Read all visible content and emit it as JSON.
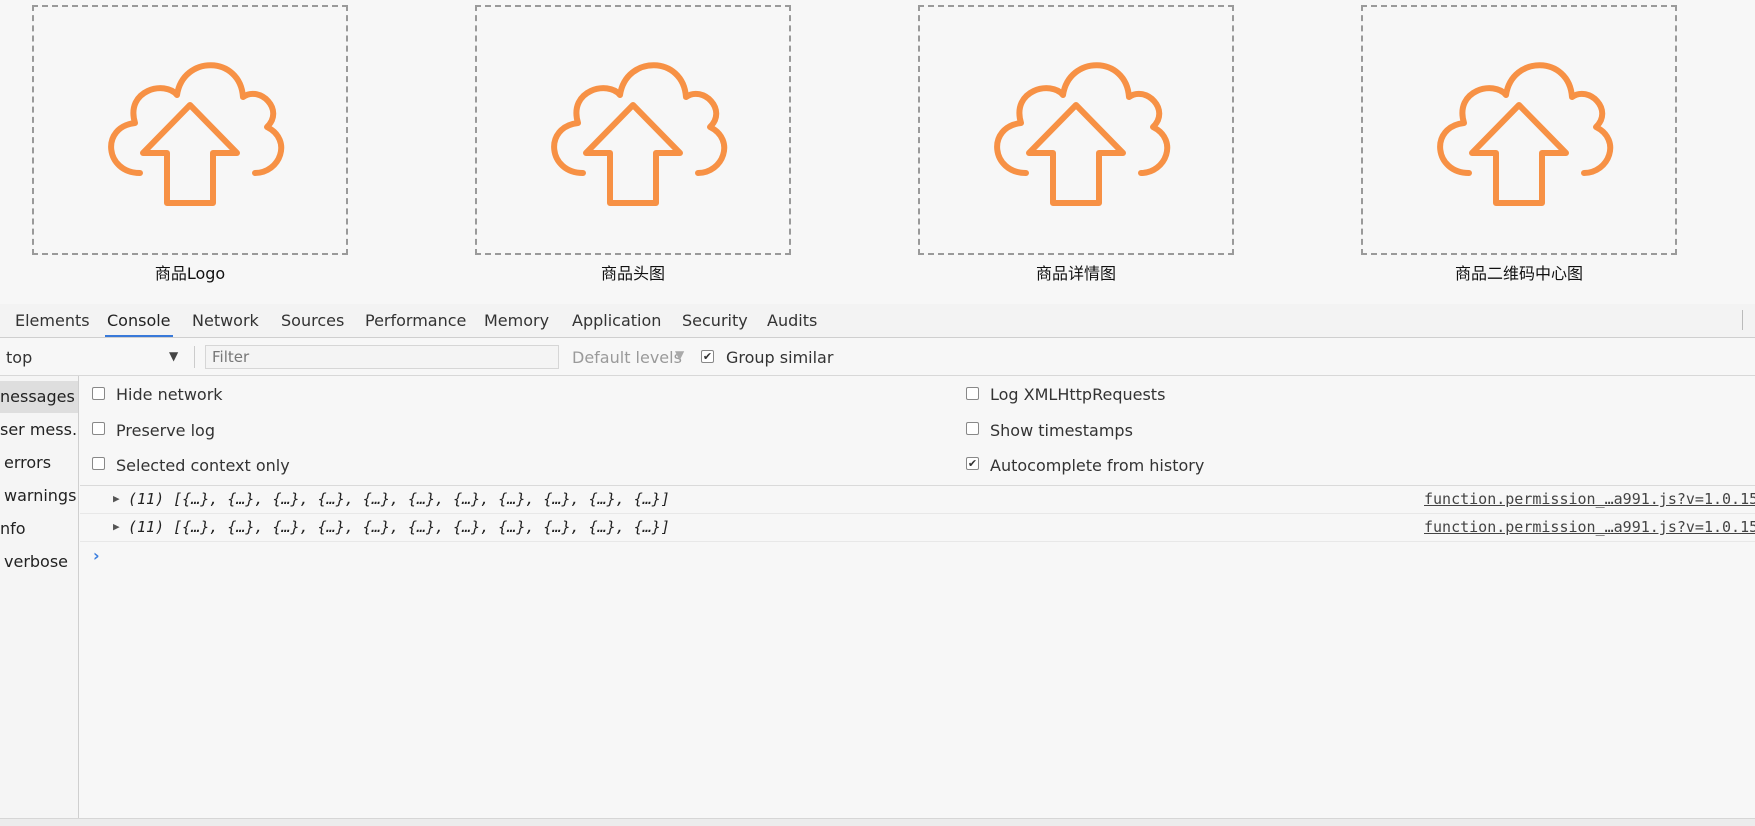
{
  "uploads": [
    {
      "label": "商品Logo"
    },
    {
      "label": "商品头图"
    },
    {
      "label": "商品详情图"
    },
    {
      "label": "商品二维码中心图"
    }
  ],
  "upload_icon": "cloud-upload-icon",
  "upload_icon_color": "#f79145",
  "tabs": [
    "Elements",
    "Console",
    "Network",
    "Sources",
    "Performance",
    "Memory",
    "Application",
    "Security",
    "Audits"
  ],
  "active_tab": "Console",
  "toolbar": {
    "context": "top",
    "filter_placeholder": "Filter",
    "levels": "Default levels",
    "group_similar": "Group similar"
  },
  "sidebar": {
    "items": [
      "nessages",
      "ser mess...",
      "errors",
      "warnings",
      "nfo",
      "verbose"
    ]
  },
  "settings": {
    "hide_network": "Hide network",
    "preserve_log": "Preserve log",
    "selected_context": "Selected context only",
    "log_xhr": "Log XMLHttpRequests",
    "show_timestamps": "Show timestamps",
    "autocomplete": "Autocomplete from history"
  },
  "log": [
    {
      "message": "(11) [{…}, {…}, {…}, {…}, {…}, {…}, {…}, {…}, {…}, {…}, {…}]",
      "source": "function.permission_…a991.js?v=1.0.15"
    },
    {
      "message": "(11) [{…}, {…}, {…}, {…}, {…}, {…}, {…}, {…}, {…}, {…}, {…}]",
      "source": "function.permission_…a991.js?v=1.0.15"
    }
  ],
  "accent_color": "#3879d9"
}
